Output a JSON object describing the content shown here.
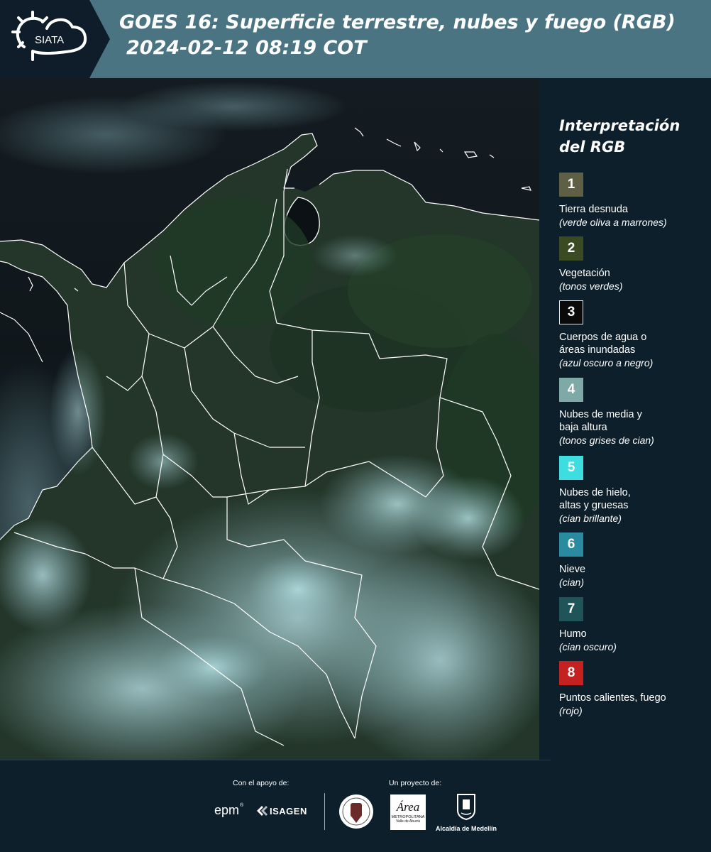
{
  "header": {
    "logo_text": "SIATA",
    "title_line1": "GOES 16: Superficie terrestre, nubes y fuego (RGB)",
    "title_line2": "2024-02-12 08:19 COT"
  },
  "legend": {
    "title_line1": "Interpretación",
    "title_line2": "del RGB",
    "items": [
      {
        "number": "1",
        "color": "#5f5f45",
        "label_lines": [
          "Tierra desnuda"
        ],
        "note": "(verde oliva a marrones)"
      },
      {
        "number": "2",
        "color": "#3a4a22",
        "label_lines": [
          "Vegetación"
        ],
        "note": "(tonos verdes)"
      },
      {
        "number": "3",
        "color": "#0a0a0a",
        "label_lines": [
          "Cuerpos de agua o",
          "áreas inundadas"
        ],
        "note": "(azul oscuro a negro)"
      },
      {
        "number": "4",
        "color": "#7fa9a7",
        "label_lines": [
          "Nubes de media y",
          "baja altura"
        ],
        "note": "(tonos grises de cian)"
      },
      {
        "number": "5",
        "color": "#3ddde0",
        "label_lines": [
          "Nubes de hielo,",
          "altas y gruesas"
        ],
        "note": "(cian brillante)"
      },
      {
        "number": "6",
        "color": "#2a8aa0",
        "label_lines": [
          "Nieve"
        ],
        "note": "(cian)"
      },
      {
        "number": "7",
        "color": "#1f5558",
        "label_lines": [
          "Humo"
        ],
        "note": "(cian oscuro)"
      },
      {
        "number": "8",
        "color": "#c62121",
        "label_lines": [
          "Puntos calientes, fuego"
        ],
        "note": "(rojo)"
      }
    ]
  },
  "footer": {
    "support_label": "Con el apoyo de:",
    "project_label": "Un proyecto de:",
    "epm_text": "epm",
    "isagen_text": "ISAGEN",
    "area_text": "Área",
    "area_sub1": "METROPOLITANA",
    "area_sub2": "Valle de Aburrá",
    "alcaldia_text": "Alcaldía de Medellín"
  },
  "map": {
    "colors": {
      "ocean": "#121a1e",
      "land": "#2b3d2c",
      "border": "#ffffff",
      "cloud": "#7fa9ad"
    }
  }
}
